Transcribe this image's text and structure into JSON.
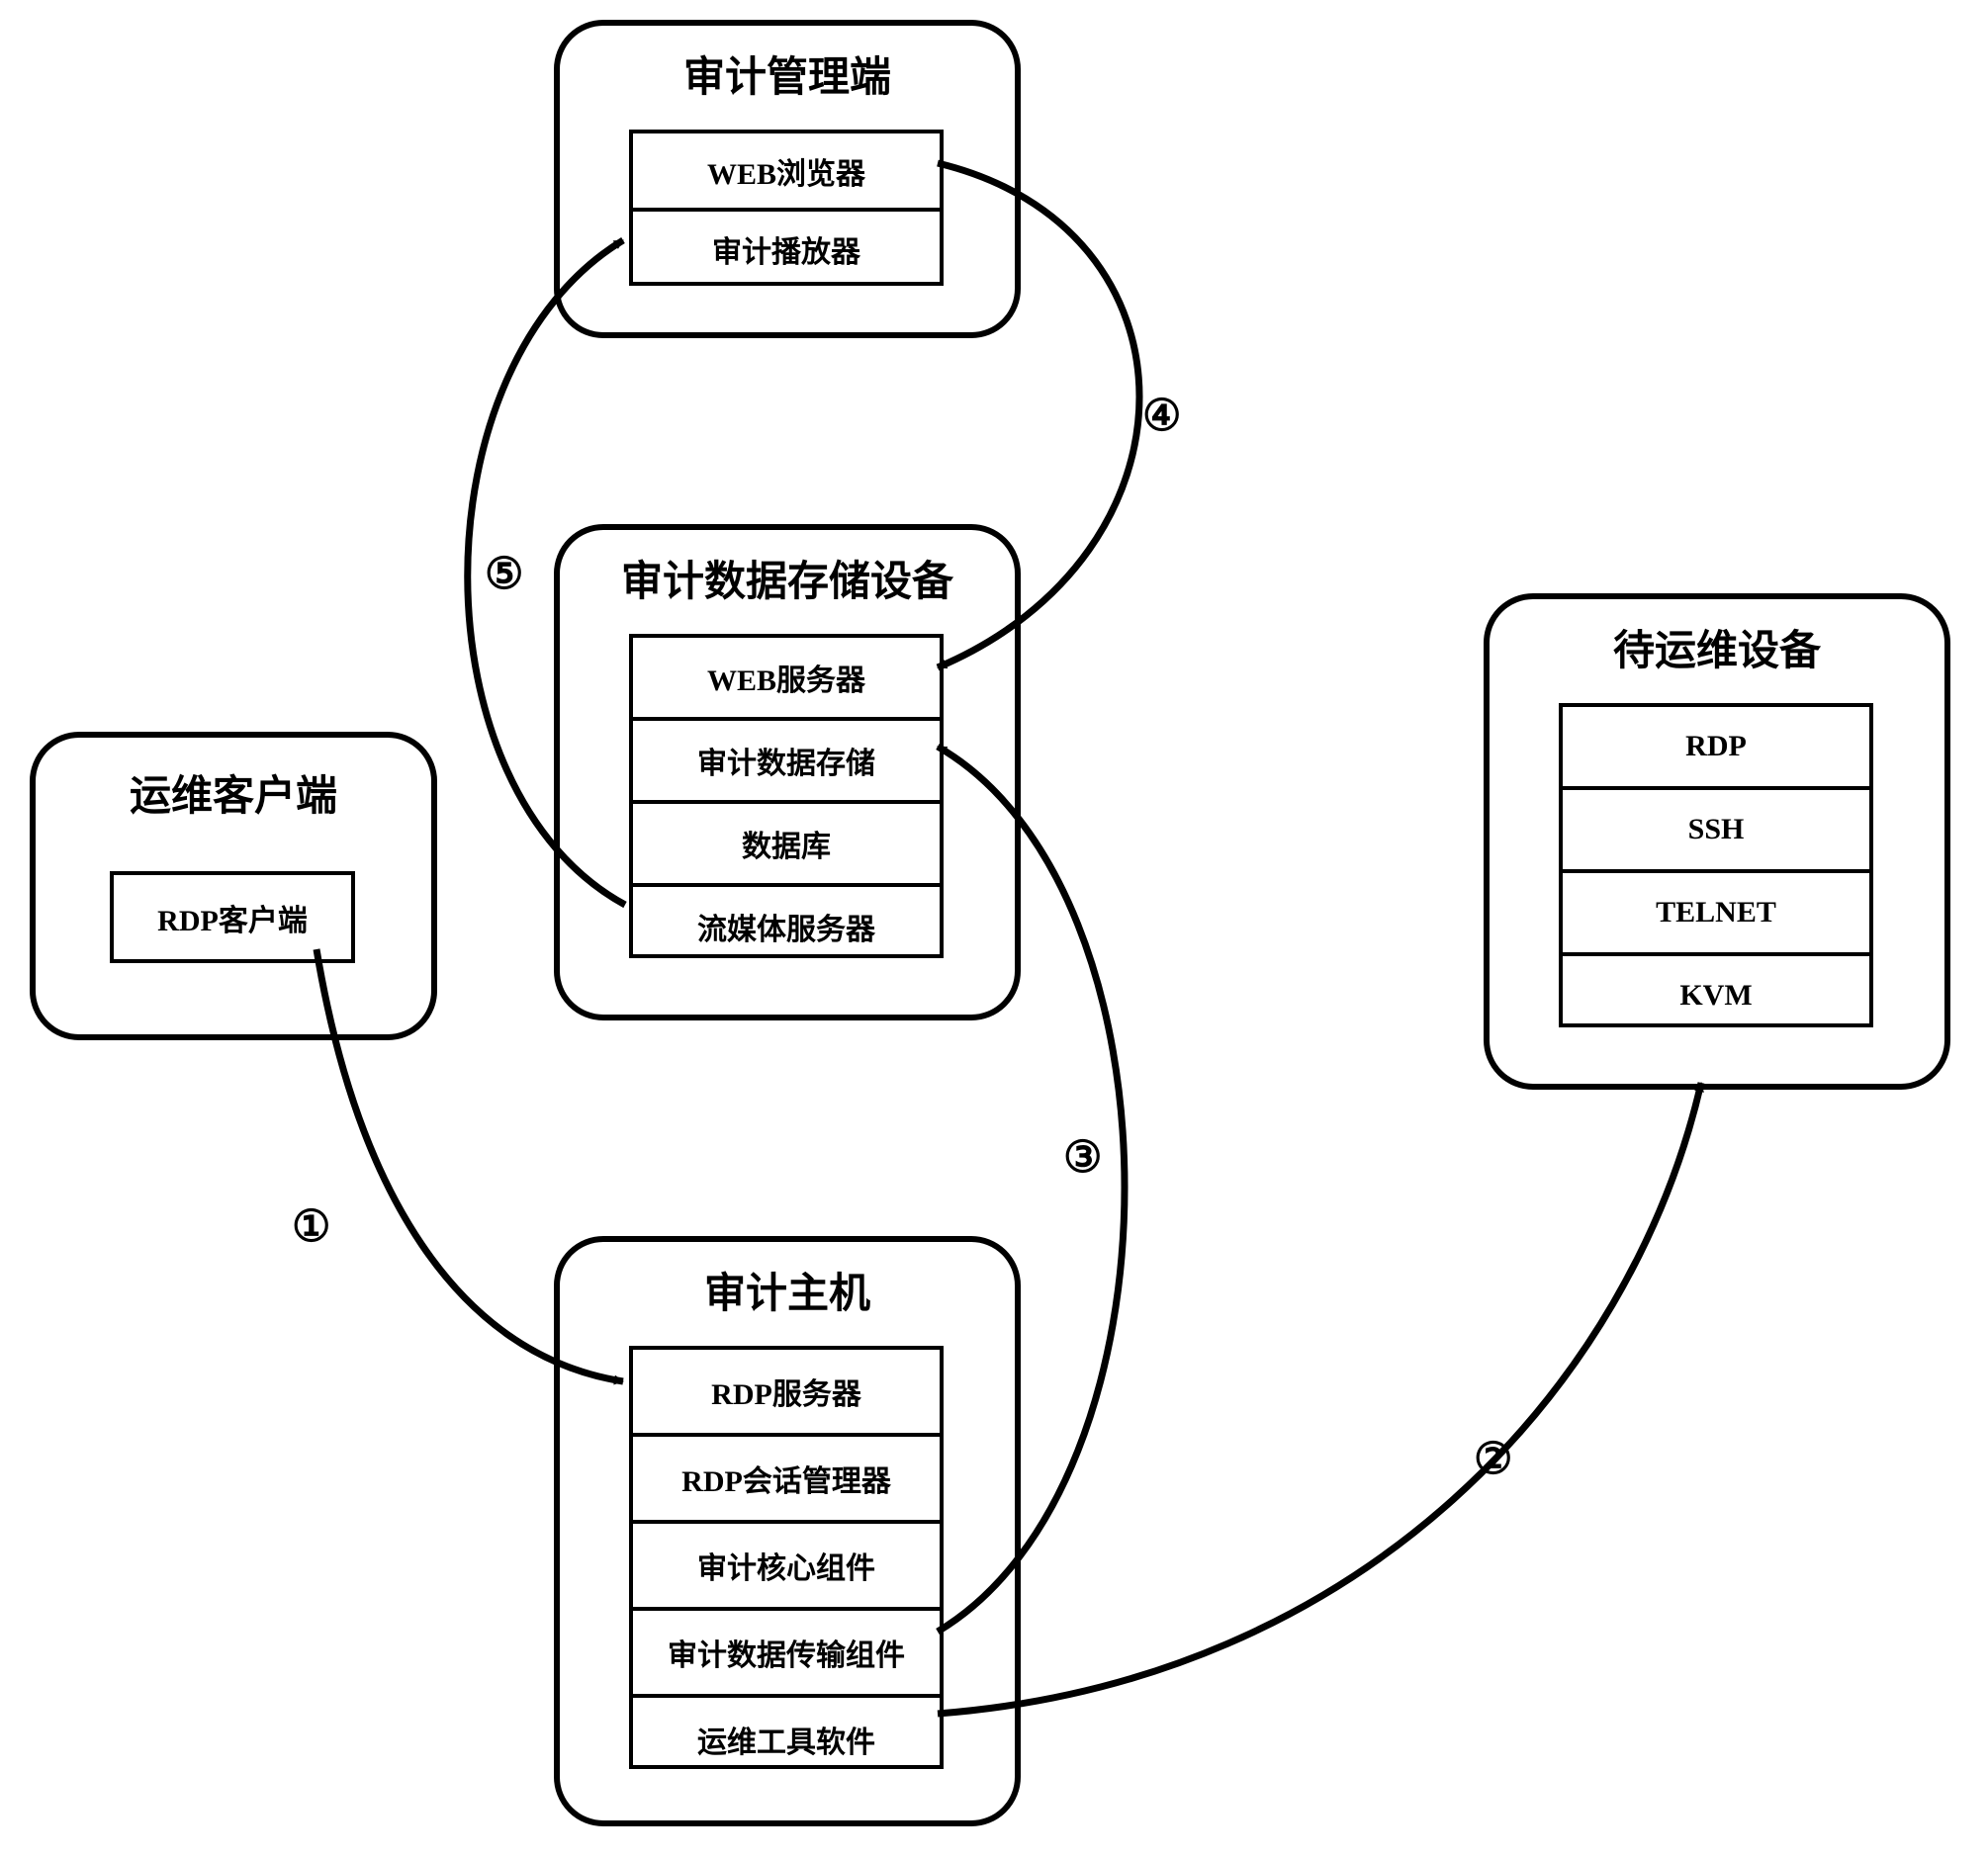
{
  "nodes": {
    "audit_mgmt": {
      "title": "审计管理端",
      "items": [
        "WEB浏览器",
        "审计播放器"
      ]
    },
    "audit_storage": {
      "title": "审计数据存储设备",
      "items": [
        "WEB服务器",
        "审计数据存储",
        "数据库",
        "流媒体服务器"
      ]
    },
    "ops_client": {
      "title": "运维客户端",
      "items": [
        "RDP客户端"
      ]
    },
    "audit_host": {
      "title": "审计主机",
      "items": [
        "RDP服务器",
        "RDP会话管理器",
        "审计核心组件",
        "审计数据传输组件",
        "运维工具软件"
      ]
    },
    "target_device": {
      "title": "待运维设备",
      "items": [
        "RDP",
        "SSH",
        "TELNET",
        "KVM"
      ]
    }
  },
  "labels": {
    "c1": "①",
    "c2": "②",
    "c3": "③",
    "c4": "④",
    "c5": "⑤"
  }
}
